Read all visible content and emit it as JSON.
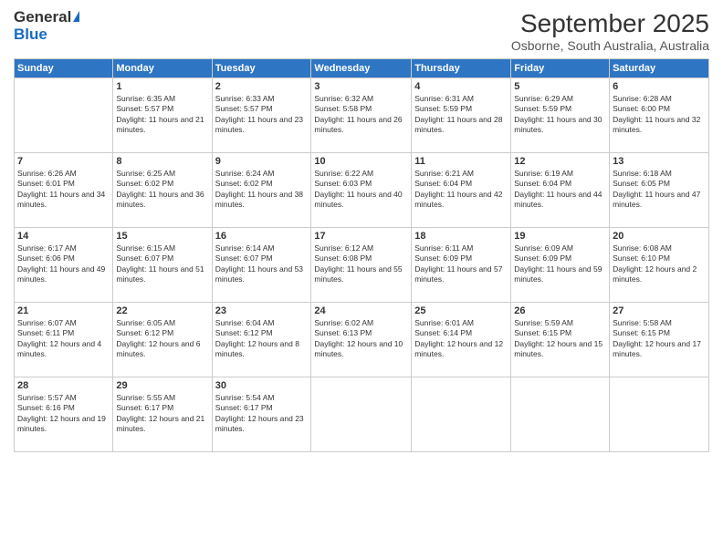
{
  "header": {
    "logo_general": "General",
    "logo_blue": "Blue",
    "month_title": "September 2025",
    "subtitle": "Osborne, South Australia, Australia"
  },
  "days_of_week": [
    "Sunday",
    "Monday",
    "Tuesday",
    "Wednesday",
    "Thursday",
    "Friday",
    "Saturday"
  ],
  "weeks": [
    [
      {
        "day": "",
        "sunrise": "",
        "sunset": "",
        "daylight": ""
      },
      {
        "day": "1",
        "sunrise": "Sunrise: 6:35 AM",
        "sunset": "Sunset: 5:57 PM",
        "daylight": "Daylight: 11 hours and 21 minutes."
      },
      {
        "day": "2",
        "sunrise": "Sunrise: 6:33 AM",
        "sunset": "Sunset: 5:57 PM",
        "daylight": "Daylight: 11 hours and 23 minutes."
      },
      {
        "day": "3",
        "sunrise": "Sunrise: 6:32 AM",
        "sunset": "Sunset: 5:58 PM",
        "daylight": "Daylight: 11 hours and 26 minutes."
      },
      {
        "day": "4",
        "sunrise": "Sunrise: 6:31 AM",
        "sunset": "Sunset: 5:59 PM",
        "daylight": "Daylight: 11 hours and 28 minutes."
      },
      {
        "day": "5",
        "sunrise": "Sunrise: 6:29 AM",
        "sunset": "Sunset: 5:59 PM",
        "daylight": "Daylight: 11 hours and 30 minutes."
      },
      {
        "day": "6",
        "sunrise": "Sunrise: 6:28 AM",
        "sunset": "Sunset: 6:00 PM",
        "daylight": "Daylight: 11 hours and 32 minutes."
      }
    ],
    [
      {
        "day": "7",
        "sunrise": "Sunrise: 6:26 AM",
        "sunset": "Sunset: 6:01 PM",
        "daylight": "Daylight: 11 hours and 34 minutes."
      },
      {
        "day": "8",
        "sunrise": "Sunrise: 6:25 AM",
        "sunset": "Sunset: 6:02 PM",
        "daylight": "Daylight: 11 hours and 36 minutes."
      },
      {
        "day": "9",
        "sunrise": "Sunrise: 6:24 AM",
        "sunset": "Sunset: 6:02 PM",
        "daylight": "Daylight: 11 hours and 38 minutes."
      },
      {
        "day": "10",
        "sunrise": "Sunrise: 6:22 AM",
        "sunset": "Sunset: 6:03 PM",
        "daylight": "Daylight: 11 hours and 40 minutes."
      },
      {
        "day": "11",
        "sunrise": "Sunrise: 6:21 AM",
        "sunset": "Sunset: 6:04 PM",
        "daylight": "Daylight: 11 hours and 42 minutes."
      },
      {
        "day": "12",
        "sunrise": "Sunrise: 6:19 AM",
        "sunset": "Sunset: 6:04 PM",
        "daylight": "Daylight: 11 hours and 44 minutes."
      },
      {
        "day": "13",
        "sunrise": "Sunrise: 6:18 AM",
        "sunset": "Sunset: 6:05 PM",
        "daylight": "Daylight: 11 hours and 47 minutes."
      }
    ],
    [
      {
        "day": "14",
        "sunrise": "Sunrise: 6:17 AM",
        "sunset": "Sunset: 6:06 PM",
        "daylight": "Daylight: 11 hours and 49 minutes."
      },
      {
        "day": "15",
        "sunrise": "Sunrise: 6:15 AM",
        "sunset": "Sunset: 6:07 PM",
        "daylight": "Daylight: 11 hours and 51 minutes."
      },
      {
        "day": "16",
        "sunrise": "Sunrise: 6:14 AM",
        "sunset": "Sunset: 6:07 PM",
        "daylight": "Daylight: 11 hours and 53 minutes."
      },
      {
        "day": "17",
        "sunrise": "Sunrise: 6:12 AM",
        "sunset": "Sunset: 6:08 PM",
        "daylight": "Daylight: 11 hours and 55 minutes."
      },
      {
        "day": "18",
        "sunrise": "Sunrise: 6:11 AM",
        "sunset": "Sunset: 6:09 PM",
        "daylight": "Daylight: 11 hours and 57 minutes."
      },
      {
        "day": "19",
        "sunrise": "Sunrise: 6:09 AM",
        "sunset": "Sunset: 6:09 PM",
        "daylight": "Daylight: 11 hours and 59 minutes."
      },
      {
        "day": "20",
        "sunrise": "Sunrise: 6:08 AM",
        "sunset": "Sunset: 6:10 PM",
        "daylight": "Daylight: 12 hours and 2 minutes."
      }
    ],
    [
      {
        "day": "21",
        "sunrise": "Sunrise: 6:07 AM",
        "sunset": "Sunset: 6:11 PM",
        "daylight": "Daylight: 12 hours and 4 minutes."
      },
      {
        "day": "22",
        "sunrise": "Sunrise: 6:05 AM",
        "sunset": "Sunset: 6:12 PM",
        "daylight": "Daylight: 12 hours and 6 minutes."
      },
      {
        "day": "23",
        "sunrise": "Sunrise: 6:04 AM",
        "sunset": "Sunset: 6:12 PM",
        "daylight": "Daylight: 12 hours and 8 minutes."
      },
      {
        "day": "24",
        "sunrise": "Sunrise: 6:02 AM",
        "sunset": "Sunset: 6:13 PM",
        "daylight": "Daylight: 12 hours and 10 minutes."
      },
      {
        "day": "25",
        "sunrise": "Sunrise: 6:01 AM",
        "sunset": "Sunset: 6:14 PM",
        "daylight": "Daylight: 12 hours and 12 minutes."
      },
      {
        "day": "26",
        "sunrise": "Sunrise: 5:59 AM",
        "sunset": "Sunset: 6:15 PM",
        "daylight": "Daylight: 12 hours and 15 minutes."
      },
      {
        "day": "27",
        "sunrise": "Sunrise: 5:58 AM",
        "sunset": "Sunset: 6:15 PM",
        "daylight": "Daylight: 12 hours and 17 minutes."
      }
    ],
    [
      {
        "day": "28",
        "sunrise": "Sunrise: 5:57 AM",
        "sunset": "Sunset: 6:16 PM",
        "daylight": "Daylight: 12 hours and 19 minutes."
      },
      {
        "day": "29",
        "sunrise": "Sunrise: 5:55 AM",
        "sunset": "Sunset: 6:17 PM",
        "daylight": "Daylight: 12 hours and 21 minutes."
      },
      {
        "day": "30",
        "sunrise": "Sunrise: 5:54 AM",
        "sunset": "Sunset: 6:17 PM",
        "daylight": "Daylight: 12 hours and 23 minutes."
      },
      {
        "day": "",
        "sunrise": "",
        "sunset": "",
        "daylight": ""
      },
      {
        "day": "",
        "sunrise": "",
        "sunset": "",
        "daylight": ""
      },
      {
        "day": "",
        "sunrise": "",
        "sunset": "",
        "daylight": ""
      },
      {
        "day": "",
        "sunrise": "",
        "sunset": "",
        "daylight": ""
      }
    ]
  ]
}
